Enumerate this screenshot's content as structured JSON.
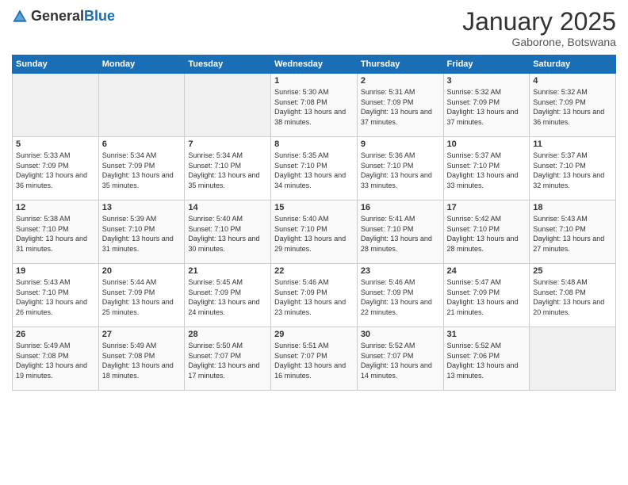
{
  "header": {
    "logo_general": "General",
    "logo_blue": "Blue",
    "month_title": "January 2025",
    "location": "Gaborone, Botswana"
  },
  "days_of_week": [
    "Sunday",
    "Monday",
    "Tuesday",
    "Wednesday",
    "Thursday",
    "Friday",
    "Saturday"
  ],
  "weeks": [
    [
      {
        "day": "",
        "sunrise": "",
        "sunset": "",
        "daylight": ""
      },
      {
        "day": "",
        "sunrise": "",
        "sunset": "",
        "daylight": ""
      },
      {
        "day": "",
        "sunrise": "",
        "sunset": "",
        "daylight": ""
      },
      {
        "day": "1",
        "sunrise": "5:30 AM",
        "sunset": "7:08 PM",
        "daylight": "13 hours and 38 minutes."
      },
      {
        "day": "2",
        "sunrise": "5:31 AM",
        "sunset": "7:09 PM",
        "daylight": "13 hours and 37 minutes."
      },
      {
        "day": "3",
        "sunrise": "5:32 AM",
        "sunset": "7:09 PM",
        "daylight": "13 hours and 37 minutes."
      },
      {
        "day": "4",
        "sunrise": "5:32 AM",
        "sunset": "7:09 PM",
        "daylight": "13 hours and 36 minutes."
      }
    ],
    [
      {
        "day": "5",
        "sunrise": "5:33 AM",
        "sunset": "7:09 PM",
        "daylight": "13 hours and 36 minutes."
      },
      {
        "day": "6",
        "sunrise": "5:34 AM",
        "sunset": "7:09 PM",
        "daylight": "13 hours and 35 minutes."
      },
      {
        "day": "7",
        "sunrise": "5:34 AM",
        "sunset": "7:10 PM",
        "daylight": "13 hours and 35 minutes."
      },
      {
        "day": "8",
        "sunrise": "5:35 AM",
        "sunset": "7:10 PM",
        "daylight": "13 hours and 34 minutes."
      },
      {
        "day": "9",
        "sunrise": "5:36 AM",
        "sunset": "7:10 PM",
        "daylight": "13 hours and 33 minutes."
      },
      {
        "day": "10",
        "sunrise": "5:37 AM",
        "sunset": "7:10 PM",
        "daylight": "13 hours and 33 minutes."
      },
      {
        "day": "11",
        "sunrise": "5:37 AM",
        "sunset": "7:10 PM",
        "daylight": "13 hours and 32 minutes."
      }
    ],
    [
      {
        "day": "12",
        "sunrise": "5:38 AM",
        "sunset": "7:10 PM",
        "daylight": "13 hours and 31 minutes."
      },
      {
        "day": "13",
        "sunrise": "5:39 AM",
        "sunset": "7:10 PM",
        "daylight": "13 hours and 31 minutes."
      },
      {
        "day": "14",
        "sunrise": "5:40 AM",
        "sunset": "7:10 PM",
        "daylight": "13 hours and 30 minutes."
      },
      {
        "day": "15",
        "sunrise": "5:40 AM",
        "sunset": "7:10 PM",
        "daylight": "13 hours and 29 minutes."
      },
      {
        "day": "16",
        "sunrise": "5:41 AM",
        "sunset": "7:10 PM",
        "daylight": "13 hours and 28 minutes."
      },
      {
        "day": "17",
        "sunrise": "5:42 AM",
        "sunset": "7:10 PM",
        "daylight": "13 hours and 28 minutes."
      },
      {
        "day": "18",
        "sunrise": "5:43 AM",
        "sunset": "7:10 PM",
        "daylight": "13 hours and 27 minutes."
      }
    ],
    [
      {
        "day": "19",
        "sunrise": "5:43 AM",
        "sunset": "7:10 PM",
        "daylight": "13 hours and 26 minutes."
      },
      {
        "day": "20",
        "sunrise": "5:44 AM",
        "sunset": "7:09 PM",
        "daylight": "13 hours and 25 minutes."
      },
      {
        "day": "21",
        "sunrise": "5:45 AM",
        "sunset": "7:09 PM",
        "daylight": "13 hours and 24 minutes."
      },
      {
        "day": "22",
        "sunrise": "5:46 AM",
        "sunset": "7:09 PM",
        "daylight": "13 hours and 23 minutes."
      },
      {
        "day": "23",
        "sunrise": "5:46 AM",
        "sunset": "7:09 PM",
        "daylight": "13 hours and 22 minutes."
      },
      {
        "day": "24",
        "sunrise": "5:47 AM",
        "sunset": "7:09 PM",
        "daylight": "13 hours and 21 minutes."
      },
      {
        "day": "25",
        "sunrise": "5:48 AM",
        "sunset": "7:08 PM",
        "daylight": "13 hours and 20 minutes."
      }
    ],
    [
      {
        "day": "26",
        "sunrise": "5:49 AM",
        "sunset": "7:08 PM",
        "daylight": "13 hours and 19 minutes."
      },
      {
        "day": "27",
        "sunrise": "5:49 AM",
        "sunset": "7:08 PM",
        "daylight": "13 hours and 18 minutes."
      },
      {
        "day": "28",
        "sunrise": "5:50 AM",
        "sunset": "7:07 PM",
        "daylight": "13 hours and 17 minutes."
      },
      {
        "day": "29",
        "sunrise": "5:51 AM",
        "sunset": "7:07 PM",
        "daylight": "13 hours and 16 minutes."
      },
      {
        "day": "30",
        "sunrise": "5:52 AM",
        "sunset": "7:07 PM",
        "daylight": "13 hours and 14 minutes."
      },
      {
        "day": "31",
        "sunrise": "5:52 AM",
        "sunset": "7:06 PM",
        "daylight": "13 hours and 13 minutes."
      },
      {
        "day": "",
        "sunrise": "",
        "sunset": "",
        "daylight": ""
      }
    ]
  ]
}
